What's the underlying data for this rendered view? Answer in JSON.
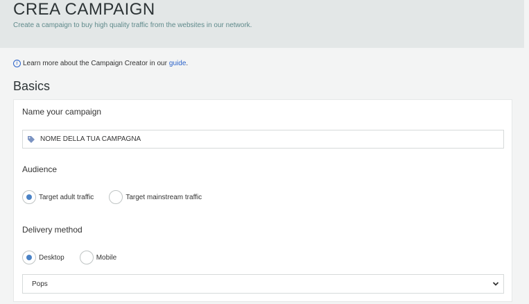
{
  "header": {
    "title": "CREA CAMPAIGN",
    "subtitle": "Create a campaign to buy high quality traffic from the websites in our network."
  },
  "guide": {
    "text": "Learn more about the Campaign Creator in our",
    "link": "guide",
    "suffix": "."
  },
  "basics": {
    "title": "Basics",
    "name_label": "Name your campaign",
    "name_value": "NOME DELLA TUA CAMPAGNA",
    "audience_label": "Audience",
    "audience_options": [
      {
        "label": "Target adult traffic",
        "checked": true
      },
      {
        "label": "Target mainstream traffic",
        "checked": false
      }
    ],
    "delivery_label": "Delivery method",
    "delivery_options": [
      {
        "label": "Desktop",
        "checked": true
      },
      {
        "label": "Mobile",
        "checked": false
      }
    ],
    "format_selected": "Pops"
  },
  "colors": {
    "accent": "#2a62c9",
    "radio_selected": "#4a82c6",
    "header_bg": "#e3e7e7"
  }
}
